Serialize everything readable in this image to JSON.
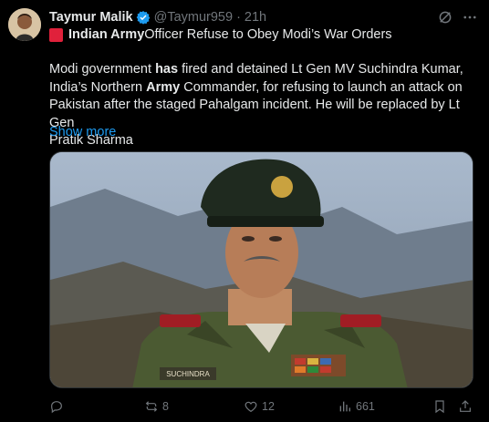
{
  "author": {
    "name": "Taymur Malik",
    "handle": "@Taymur959",
    "separator": "·",
    "time": "21h"
  },
  "title": {
    "part1": "Indian Army",
    "part2": " Officer Refuse to Obey Modi’s War Orders"
  },
  "body": {
    "line1_a": "Modi government ",
    "line1_b": "has",
    "line1_c": " fired and detained Lt Gen MV Suchindra Kumar,",
    "line2_a": "India’s Northern ",
    "line2_b": "Army",
    "line2_c": " Commander, for refusing to launch an attack on",
    "line3": "Pakistan after the staged Pahalgam incident. He will be replaced by Lt Gen",
    "line4": "Pratik Sharma"
  },
  "show_more": "Show more",
  "media": {
    "name_tag": "SUCHINDRA"
  },
  "actions": {
    "replies": "",
    "reposts": "8",
    "likes": "12",
    "views": "661"
  },
  "colors": {
    "background": "#000000",
    "text": "#e7e9ea",
    "muted": "#71767b",
    "link": "#1d9bf0",
    "verified": "#1d9bf0",
    "red_square": "#e0213b"
  },
  "icons": [
    "verified-badge-icon",
    "grok-icon",
    "more-icon",
    "reply-icon",
    "repost-icon",
    "like-icon",
    "views-icon",
    "bookmark-icon",
    "share-icon"
  ]
}
